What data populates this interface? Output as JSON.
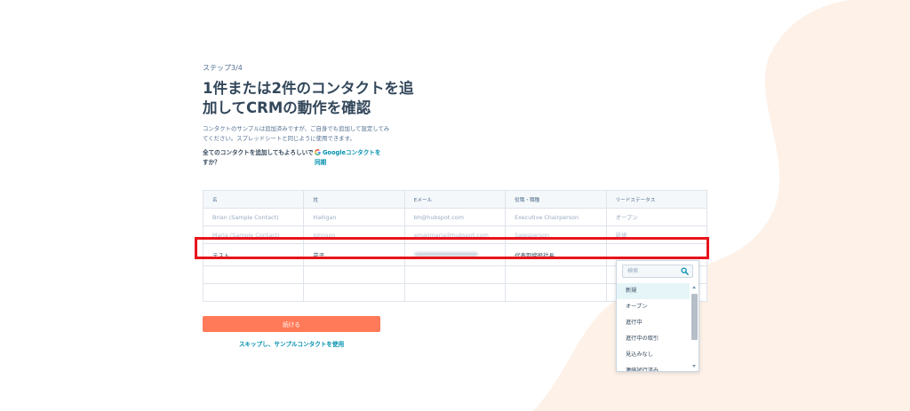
{
  "onboarding": {
    "step_label": "ステップ3/4",
    "title": "1件または2件のコンタクトを追加してCRMの動作を確認",
    "description": "コンタクトのサンプルは追加済みですが、ご自身でも追加して設定してみてください。スプレッドシートと同じように使用できます。",
    "question": "全てのコンタクトを追加してもよろしいですか？",
    "google_link": "Googleコンタクトを同期",
    "continue_button": "続ける",
    "skip_link": "スキップし、サンプルコンタクトを使用"
  },
  "table": {
    "headers": [
      "名",
      "姓",
      "Eメール",
      "役職・職種",
      "リードステータス"
    ],
    "rows": [
      [
        "Brian (Sample Contact)",
        "Halligan",
        "bh@hubspot.com",
        "Executive Chairperson",
        "オープン"
      ],
      [
        "Maria (Sample Contact)",
        "Johnson",
        "emailmaria@hubspot.com",
        "Salesperson",
        "新規"
      ],
      [
        "テスト",
        "花子",
        "",
        "代表取締役社長",
        ""
      ],
      [
        "",
        "",
        "",
        "",
        ""
      ],
      [
        "",
        "",
        "",
        "",
        ""
      ]
    ]
  },
  "dropdown": {
    "search_placeholder": "検索",
    "options": [
      "新規",
      "オープン",
      "進行中",
      "進行中の取引",
      "見込みなし",
      "連絡試行済み"
    ],
    "selected": "新規"
  },
  "colors": {
    "accent": "#ff7a59",
    "link": "#0091ae",
    "highlight": "#e8141b",
    "blob": "#fdf1e8"
  }
}
